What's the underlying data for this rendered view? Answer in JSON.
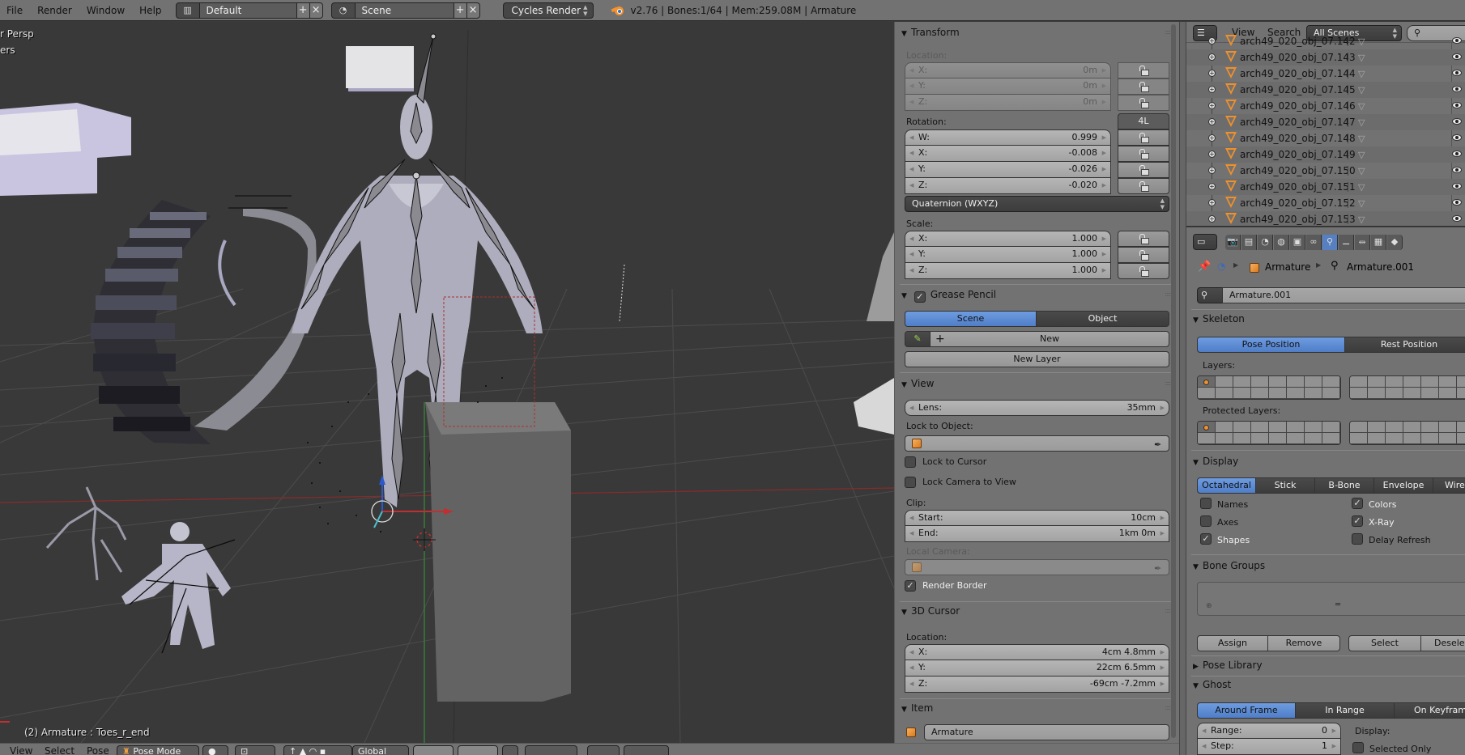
{
  "topbar": {
    "menus": [
      "File",
      "Render",
      "Window",
      "Help"
    ],
    "screen_layout": "Default",
    "scene": "Scene",
    "render_engine": "Cycles Render",
    "stats": "v2.76 | Bones:1/64  | Mem:259.08M | Armature"
  },
  "viewport": {
    "view_name": "r Persp",
    "view_sub": "ers",
    "object_info": "(2) Armature : Toes_r_end",
    "header": {
      "menus": [
        "View",
        "Select",
        "Pose"
      ],
      "mode": "Pose Mode",
      "orientation": "Global"
    },
    "colors": {
      "background": "#393939",
      "grid": "#4a4a4a",
      "x_axis": "#8c2a2a",
      "y_axis": "#3a8a3a"
    }
  },
  "npanel": {
    "transform": {
      "title": "Transform",
      "location_label": "Location:",
      "location": [
        {
          "axis": "X:",
          "value": "0m"
        },
        {
          "axis": "Y:",
          "value": "0m"
        },
        {
          "axis": "Z:",
          "value": "0m"
        }
      ],
      "rotation_label": "Rotation:",
      "rotation_lock_mode": "4L",
      "rotation": [
        {
          "axis": "W:",
          "value": "0.999"
        },
        {
          "axis": "X:",
          "value": "-0.008"
        },
        {
          "axis": "Y:",
          "value": "-0.026"
        },
        {
          "axis": "Z:",
          "value": "-0.020"
        }
      ],
      "rotation_mode": "Quaternion (WXYZ)",
      "scale_label": "Scale:",
      "scale": [
        {
          "axis": "X:",
          "value": "1.000"
        },
        {
          "axis": "Y:",
          "value": "1.000"
        },
        {
          "axis": "Z:",
          "value": "1.000"
        }
      ]
    },
    "grease_pencil": {
      "title": "Grease Pencil",
      "enabled": true,
      "source_tabs": [
        "Scene",
        "Object"
      ],
      "active_source": "Scene",
      "new_label": "New",
      "new_layer_label": "New Layer"
    },
    "view": {
      "title": "View",
      "lens_label": "Lens:",
      "lens_value": "35mm",
      "lock_to_object_label": "Lock to Object:",
      "lock_to_cursor_label": "Lock to Cursor",
      "lock_to_cursor": false,
      "lock_camera_label": "Lock Camera to View",
      "lock_camera": false,
      "clip_label": "Clip:",
      "clip_start_label": "Start:",
      "clip_start": "10cm",
      "clip_end_label": "End:",
      "clip_end": "1km 0m",
      "local_camera_label": "Local Camera:",
      "render_border_label": "Render Border",
      "render_border": true
    },
    "cursor": {
      "title": "3D Cursor",
      "location_label": "Location:",
      "location": [
        {
          "axis": "X:",
          "value": "4cm 4.8mm"
        },
        {
          "axis": "Y:",
          "value": "22cm 6.5mm"
        },
        {
          "axis": "Z:",
          "value": "-69cm -7.2mm"
        }
      ]
    },
    "item": {
      "title": "Item",
      "name": "Armature"
    }
  },
  "outliner": {
    "menus": [
      "View",
      "Search"
    ],
    "display_mode": "All Scenes",
    "search_placeholder": "",
    "rows": [
      "arch49_020_obj_07.142",
      "arch49_020_obj_07.143",
      "arch49_020_obj_07.144",
      "arch49_020_obj_07.145",
      "arch49_020_obj_07.146",
      "arch49_020_obj_07.147",
      "arch49_020_obj_07.148",
      "arch49_020_obj_07.149",
      "arch49_020_obj_07.150",
      "arch49_020_obj_07.151",
      "arch49_020_obj_07.152",
      "arch49_020_obj_07.153"
    ]
  },
  "properties": {
    "context_tabs": [
      "render",
      "render-layers",
      "scene",
      "world",
      "object",
      "constraints",
      "armature-data",
      "bone",
      "bone-constraints",
      "texture",
      "physics"
    ],
    "active_tab": "armature-data",
    "breadcrumb": [
      "Armature",
      "Armature.001"
    ],
    "datablock_name": "Armature.001",
    "skeleton": {
      "title": "Skeleton",
      "positions": [
        "Pose Position",
        "Rest Position"
      ],
      "active_position": "Pose Position",
      "layers_label": "Layers:",
      "protected_layers_label": "Protected Layers:"
    },
    "display": {
      "title": "Display",
      "types": [
        "Octahedral",
        "Stick",
        "B-Bone",
        "Envelope",
        "Wire"
      ],
      "active_type": "Octahedral",
      "options": [
        {
          "label": "Names",
          "checked": false
        },
        {
          "label": "Colors",
          "checked": true
        },
        {
          "label": "Axes",
          "checked": false
        },
        {
          "label": "X-Ray",
          "checked": true
        },
        {
          "label": "Shapes",
          "checked": true
        },
        {
          "label": "Delay Refresh",
          "checked": false
        }
      ]
    },
    "bone_groups": {
      "title": "Bone Groups",
      "buttons": [
        "Assign",
        "Remove",
        "Select",
        "Deselect"
      ]
    },
    "pose_library": {
      "title": "Pose Library"
    },
    "ghost": {
      "title": "Ghost",
      "types": [
        "Around Frame",
        "In Range",
        "On Keyframes"
      ],
      "active_type": "Around Frame",
      "range_label": "Range:",
      "range_value": "0",
      "step_label": "Step:",
      "step_value": "1",
      "display_label": "Display:",
      "selected_only_label": "Selected Only",
      "selected_only": false
    }
  }
}
